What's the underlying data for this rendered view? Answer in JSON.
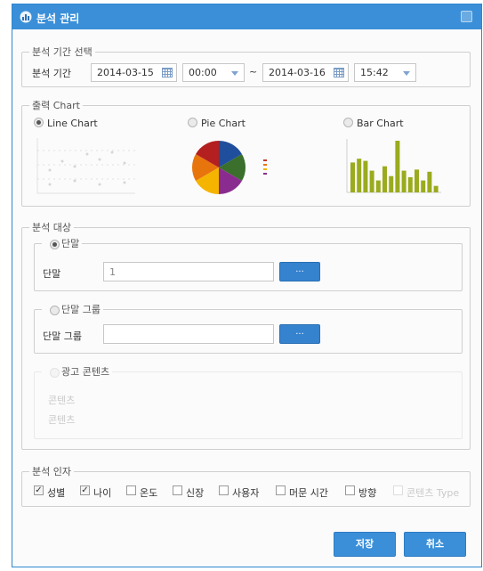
{
  "window": {
    "title": "분석 관리"
  },
  "period": {
    "legend": "분석 기간 선택",
    "label": "분석 기간",
    "start_date": "2014-03-15",
    "start_time": "00:00",
    "separator": "~",
    "end_date": "2014-03-16",
    "end_time": "15:42"
  },
  "output": {
    "legend": "출력 Chart",
    "options": [
      {
        "label": "Line Chart",
        "selected": true
      },
      {
        "label": "Pie Chart",
        "selected": false
      },
      {
        "label": "Bar Chart",
        "selected": false
      }
    ]
  },
  "target": {
    "legend": "분석 대상",
    "terminal": {
      "legend": "단말",
      "field_label": "단말",
      "value": "1",
      "browse_label": "...",
      "selected": true
    },
    "terminal_group": {
      "legend": "단말 그룹",
      "field_label": "단말 그룹",
      "value": "",
      "browse_label": "...",
      "selected": false
    },
    "ad_content": {
      "legend": "광고 콘텐츠",
      "line1": "콘텐츠",
      "line2": "콘텐츠",
      "enabled": false
    }
  },
  "factors": {
    "legend": "분석 인자",
    "items": [
      {
        "label": "성별",
        "checked": true,
        "enabled": true
      },
      {
        "label": "나이",
        "checked": true,
        "enabled": true
      },
      {
        "label": "온도",
        "checked": false,
        "enabled": true
      },
      {
        "label": "신장",
        "checked": false,
        "enabled": true
      },
      {
        "label": "사용자",
        "checked": false,
        "enabled": true
      },
      {
        "label": "머문 시간",
        "checked": false,
        "enabled": true
      },
      {
        "label": "방향",
        "checked": false,
        "enabled": true
      },
      {
        "label": "콘텐츠 Type",
        "checked": false,
        "enabled": false
      }
    ]
  },
  "buttons": {
    "save": "저장",
    "cancel": "취소"
  },
  "colors": {
    "accent": "#3a8fd8",
    "bar_color": "#9aab1e",
    "pie": [
      "#1f4e9c",
      "#3a6f2c",
      "#8a2c8f",
      "#f5b400",
      "#e8740c",
      "#b41f1f"
    ]
  },
  "previews": {
    "bar_values": [
      55,
      62,
      58,
      40,
      22,
      48,
      30,
      95,
      40,
      28,
      42,
      22,
      38,
      12
    ]
  }
}
